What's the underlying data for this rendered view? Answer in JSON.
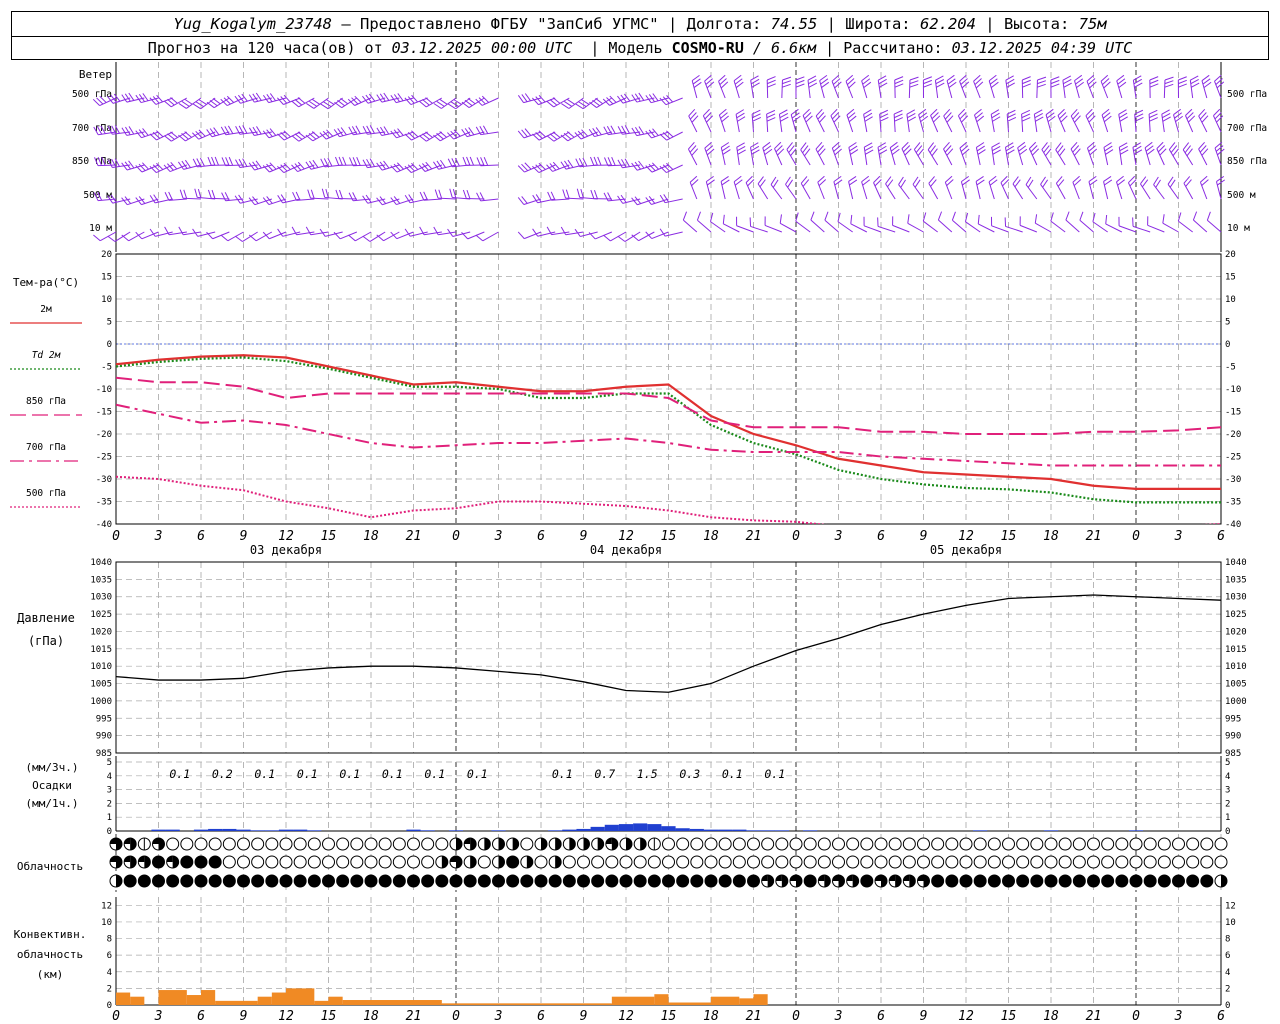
{
  "header": {
    "station": "Yug_Kogalym_23748",
    "provider": "— Предоставлено ФГБУ \"ЗапСиб УГМС\"",
    "lon_label": "Долгота:",
    "lon_value": "74.55",
    "lat_label": "Широта:",
    "lat_value": "62.204",
    "alt_label": "Высота:",
    "alt_value": "75м",
    "forecast_prefix": "Прогноз на 120 часа(ов) от",
    "forecast_start": "03.12.2025 00:00 UTC",
    "model_label": "Модель",
    "model_name": "COSMO-RU",
    "model_res": "/ 6.6км",
    "computed_label": "Рассчитано:",
    "computed_value": "03.12.2025 04:39 UTC"
  },
  "chart_data": [
    {
      "id": "wind",
      "type": "wind-barbs",
      "title": "Ветер",
      "levels": [
        "500 гПа",
        "700 гПа",
        "850 гПа",
        "500 м",
        "10 м"
      ],
      "color": "#8a2be2"
    },
    {
      "id": "temperature",
      "type": "line",
      "ylabel": "Тем-ра(°C)",
      "ylim": [
        -40,
        20
      ],
      "yticks": [
        20,
        15,
        10,
        5,
        0,
        -5,
        -10,
        -15,
        -20,
        -25,
        -30,
        -35,
        -40
      ],
      "x": [
        0,
        3,
        6,
        9,
        12,
        15,
        18,
        21,
        24,
        27,
        30,
        33,
        36,
        39,
        42,
        45,
        48,
        51,
        54,
        57,
        60,
        63,
        66,
        69,
        72,
        75,
        78
      ],
      "series": [
        {
          "name": "2м",
          "color": "#e03030",
          "dash": "solid",
          "values": [
            -4.5,
            -3.5,
            -2.8,
            -2.5,
            -3,
            -5,
            -7,
            -9,
            -8.5,
            -9.5,
            -10.5,
            -10.5,
            -9.5,
            -9,
            -16,
            -20,
            -22.5,
            -25.5,
            -27,
            -28.5,
            -29,
            -29.5,
            -30,
            -31.5,
            -32.2,
            -32.2,
            -32.2
          ]
        },
        {
          "name": "Td 2м",
          "color": "#1a8a1a",
          "dash": "dot",
          "values": [
            -5,
            -4,
            -3.3,
            -3,
            -3.8,
            -5.5,
            -7.5,
            -9.5,
            -9.5,
            -10,
            -12,
            -12,
            -11,
            -11,
            -18,
            -22,
            -24.5,
            -28,
            -30,
            -31.2,
            -32,
            -32.3,
            -33,
            -34.5,
            -35.2,
            -35.2,
            -35.2
          ]
        },
        {
          "name": "850 гПа",
          "color": "#e0207a",
          "dash": "longdash",
          "values": [
            -7.5,
            -8.5,
            -8.5,
            -9.5,
            -12,
            -11,
            -11,
            -11,
            -11,
            -11,
            -11,
            -11,
            -11,
            -12,
            -17,
            -18.5,
            -18.5,
            -18.5,
            -19.5,
            -19.5,
            -20,
            -20,
            -20,
            -19.5,
            -19.5,
            -19.2,
            -18.5
          ]
        },
        {
          "name": "700 гПа",
          "color": "#e0207a",
          "dash": "dashdot",
          "values": [
            -13.5,
            -15.5,
            -17.5,
            -17,
            -18,
            -20,
            -22,
            -23,
            -22.5,
            -22,
            -22,
            -21.5,
            -21,
            -22,
            -23.5,
            -24,
            -24,
            -24,
            -25,
            -25.5,
            -26,
            -26.5,
            -27,
            -27,
            -27,
            -27,
            -27
          ]
        },
        {
          "name": "500 гПа",
          "color": "#e0207a",
          "dash": "dot",
          "values": [
            -29.5,
            -30,
            -31.5,
            -32.5,
            -35,
            -36.5,
            -38.5,
            -37,
            -36.5,
            -35,
            -35,
            -35.5,
            -36,
            -37,
            -38.5,
            -39.2,
            -39.5,
            -40.5,
            -41,
            -41.5,
            -42,
            -42,
            -42,
            -42,
            -41.5,
            -40.5,
            -40
          ]
        }
      ],
      "xticklabels": [
        "0",
        "3",
        "6",
        "9",
        "12",
        "15",
        "18",
        "21",
        "0",
        "3",
        "6",
        "9",
        "12",
        "15",
        "18",
        "21",
        "0",
        "3",
        "6",
        "9",
        "12",
        "15",
        "18",
        "21",
        "0",
        "3",
        "6"
      ],
      "days": [
        "03 декабря",
        "04 декабря",
        "05 декабря"
      ]
    },
    {
      "id": "pressure",
      "type": "line",
      "ylabel": "Давление",
      "yunit": "(гПа)",
      "ylim": [
        985,
        1040
      ],
      "yticks": [
        1040,
        1035,
        1030,
        1025,
        1020,
        1015,
        1010,
        1005,
        1000,
        995,
        990,
        985
      ],
      "x": [
        0,
        3,
        6,
        9,
        12,
        15,
        18,
        21,
        24,
        27,
        30,
        33,
        36,
        39,
        42,
        45,
        48,
        51,
        54,
        57,
        60,
        63,
        66,
        69,
        72,
        75,
        78
      ],
      "values": [
        1007,
        1006,
        1006,
        1006.5,
        1008.5,
        1009.5,
        1010,
        1010,
        1009.5,
        1008.5,
        1007.5,
        1005.5,
        1003,
        1002.5,
        1005,
        1010,
        1014.5,
        1018,
        1022,
        1025,
        1027.5,
        1029.5,
        1030,
        1030.5,
        1030,
        1029.5,
        1029
      ]
    },
    {
      "id": "precip",
      "type": "bar",
      "ylabel_top": "(мм/3ч.)",
      "ylabel": "Осадки",
      "ylabel_bottom": "(мм/1ч.)",
      "ylim": [
        0,
        5
      ],
      "yticks": [
        5,
        4,
        3,
        2,
        1,
        0
      ],
      "labels_3h": [
        {
          "x": 4.5,
          "v": "0.1"
        },
        {
          "x": 7.5,
          "v": "0.2"
        },
        {
          "x": 10.5,
          "v": "0.1"
        },
        {
          "x": 13.5,
          "v": "0.1"
        },
        {
          "x": 16.5,
          "v": "0.1"
        },
        {
          "x": 19.5,
          "v": "0.1"
        },
        {
          "x": 22.5,
          "v": "0.1"
        },
        {
          "x": 25.5,
          "v": "0.1"
        },
        {
          "x": 31.5,
          "v": "0.1"
        },
        {
          "x": 34.5,
          "v": "0.7"
        },
        {
          "x": 37.5,
          "v": "1.5"
        },
        {
          "x": 40.5,
          "v": "0.3"
        },
        {
          "x": 43.5,
          "v": "0.1"
        },
        {
          "x": 46.5,
          "v": "0.1"
        }
      ],
      "bars_1h": [
        {
          "x": 3,
          "v": 0.1
        },
        {
          "x": 4,
          "v": 0.1
        },
        {
          "x": 6,
          "v": 0.1
        },
        {
          "x": 7,
          "v": 0.15
        },
        {
          "x": 8,
          "v": 0.15
        },
        {
          "x": 9,
          "v": 0.1
        },
        {
          "x": 10,
          "v": 0.05
        },
        {
          "x": 11,
          "v": 0.05
        },
        {
          "x": 12,
          "v": 0.1
        },
        {
          "x": 13,
          "v": 0.1
        },
        {
          "x": 14,
          "v": 0.05
        },
        {
          "x": 21,
          "v": 0.1
        },
        {
          "x": 22,
          "v": 0.05
        },
        {
          "x": 24,
          "v": 0.05
        },
        {
          "x": 27,
          "v": 0.05
        },
        {
          "x": 31,
          "v": 0.05
        },
        {
          "x": 32,
          "v": 0.1
        },
        {
          "x": 33,
          "v": 0.15
        },
        {
          "x": 34,
          "v": 0.3
        },
        {
          "x": 35,
          "v": 0.45
        },
        {
          "x": 36,
          "v": 0.5
        },
        {
          "x": 37,
          "v": 0.55
        },
        {
          "x": 38,
          "v": 0.5
        },
        {
          "x": 39,
          "v": 0.35
        },
        {
          "x": 40,
          "v": 0.2
        },
        {
          "x": 41,
          "v": 0.15
        },
        {
          "x": 42,
          "v": 0.1
        },
        {
          "x": 43,
          "v": 0.1
        },
        {
          "x": 44,
          "v": 0.1
        },
        {
          "x": 45,
          "v": 0.05
        },
        {
          "x": 46,
          "v": 0.05
        },
        {
          "x": 47,
          "v": 0.05
        },
        {
          "x": 49,
          "v": 0.05
        },
        {
          "x": 61,
          "v": 0.05
        },
        {
          "x": 66,
          "v": 0.05
        },
        {
          "x": 72,
          "v": 0.05
        }
      ],
      "color": "#2040d0"
    },
    {
      "id": "clouds",
      "type": "symbols",
      "ylabel": "Облачность",
      "rows": [
        "3313000000000000000000002322202222232210000000000000000000000000000000000000000",
        "3334344400000000000000023202420200000000000000000000000000000000000000000000000",
        "2444444444444444444444444444444444444444444444333433343333444444444444444444442"
      ]
    },
    {
      "id": "convective",
      "type": "bar",
      "ylabel": "Конвективн.",
      "ylabel2": "облачность",
      "yunit": "(км)",
      "ylim": [
        0,
        13
      ],
      "yticks": [
        12,
        10,
        8,
        6,
        4,
        2,
        0
      ],
      "bars": [
        {
          "x0": 0,
          "x1": 1,
          "v": 1.5
        },
        {
          "x0": 1,
          "x1": 2,
          "v": 1
        },
        {
          "x0": 3,
          "x1": 5,
          "v": 1.8
        },
        {
          "x0": 5,
          "x1": 6,
          "v": 1.2
        },
        {
          "x0": 6,
          "x1": 7,
          "v": 1.8
        },
        {
          "x0": 7,
          "x1": 10,
          "v": 0.5
        },
        {
          "x0": 10,
          "x1": 11,
          "v": 1
        },
        {
          "x0": 11,
          "x1": 12,
          "v": 1.5
        },
        {
          "x0": 12,
          "x1": 14,
          "v": 2
        },
        {
          "x0": 14,
          "x1": 15,
          "v": 0.5
        },
        {
          "x0": 15,
          "x1": 16,
          "v": 1
        },
        {
          "x0": 16,
          "x1": 23,
          "v": 0.6
        },
        {
          "x0": 23,
          "x1": 35,
          "v": 0.2
        },
        {
          "x0": 35,
          "x1": 38,
          "v": 1
        },
        {
          "x0": 38,
          "x1": 39,
          "v": 1.3
        },
        {
          "x0": 39,
          "x1": 42,
          "v": 0.3
        },
        {
          "x0": 42,
          "x1": 44,
          "v": 1
        },
        {
          "x0": 44,
          "x1": 45,
          "v": 0.8
        },
        {
          "x0": 45,
          "x1": 46,
          "v": 1.3
        }
      ],
      "color": "#f08a24"
    }
  ]
}
